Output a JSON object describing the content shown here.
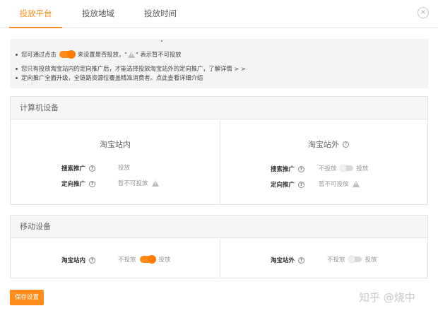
{
  "tabs": [
    {
      "label": "投放平台",
      "active": true
    },
    {
      "label": "投放地域",
      "active": false
    },
    {
      "label": "投放时间",
      "active": false
    }
  ],
  "close_icon": "×",
  "notice": {
    "line1_prefix": "您可通过点击",
    "line1_suffix_a": "来设置是否投放，\"",
    "line1_suffix_b": "\" 表示暂不可投放",
    "line2": "您只有投放淘宝站内的定向推广后，才能选择投放淘宝站外的定向推广，了解详情 > >",
    "line3": "定向推广全面升级，全链路资源位覆盖精准消费者。点此查看详细介绍"
  },
  "computer": {
    "title": "计算机设备",
    "inner": {
      "title": "淘宝站内",
      "search_label": "搜索推广",
      "search_value": "投放",
      "target_label": "定向推广",
      "target_value": "暂不可投放"
    },
    "outer": {
      "title": "淘宝站外",
      "search_label": "搜索推广",
      "search_off": "不投放",
      "search_on": "投放",
      "target_label": "定向推广",
      "target_value": "暂不可投放"
    }
  },
  "mobile": {
    "title": "移动设备",
    "inner": {
      "label": "淘宝站内",
      "off": "不投放",
      "on": "投放",
      "enabled": true
    },
    "outer": {
      "label": "淘宝站外",
      "off": "不投放",
      "on": "投放",
      "enabled": false
    }
  },
  "save_label": "保存设置",
  "watermark": "知乎 @烧中",
  "colors": {
    "accent": "#ff8c1a",
    "toggle_off": "#d9d9d9"
  }
}
